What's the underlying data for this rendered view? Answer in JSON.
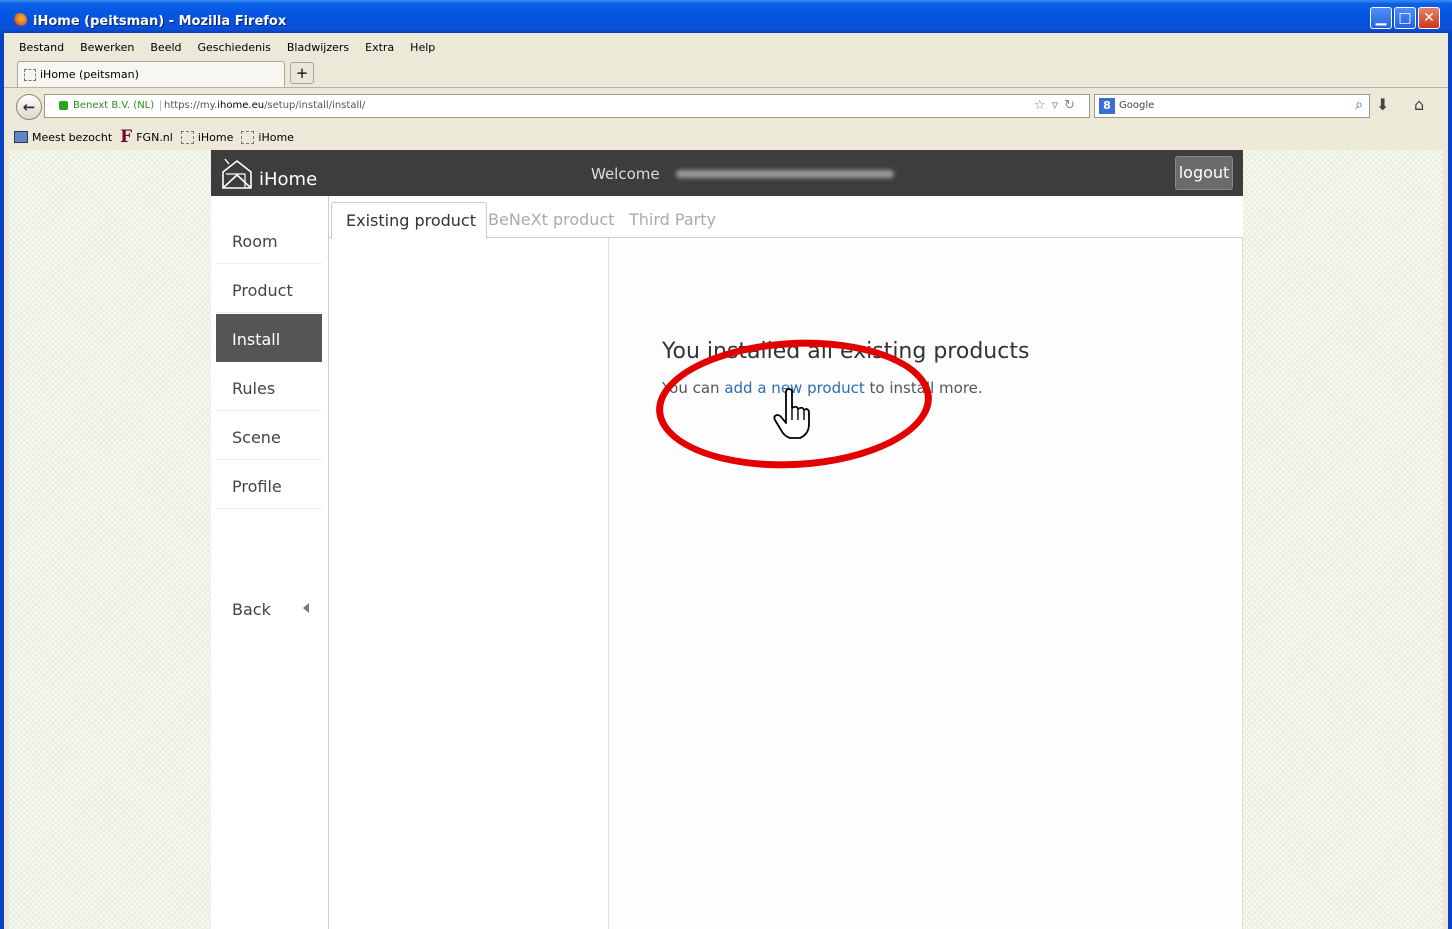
{
  "window": {
    "title": "iHome (peitsman) - Mozilla Firefox",
    "controls": [
      "minimize",
      "maximize",
      "close"
    ]
  },
  "menubar": [
    "Bestand",
    "Bewerken",
    "Beeld",
    "Geschiedenis",
    "Bladwijzers",
    "Extra",
    "Help"
  ],
  "browser": {
    "tab_title": "iHome (peitsman)",
    "new_tab_label": "+",
    "identity": "Benext B.V. (NL)",
    "url_prefix": "https://my.",
    "url_domain": "ihome.eu",
    "url_path": "/setup/install/install/",
    "search_engine": "Google",
    "bookmarks": [
      "Meest bezocht",
      "FGN.nl",
      "iHome",
      "iHome"
    ]
  },
  "app": {
    "brand": "iHome",
    "welcome": "Welcome",
    "logout": "logout",
    "sidebar": [
      {
        "label": "Room",
        "active": false
      },
      {
        "label": "Product",
        "active": false
      },
      {
        "label": "Install",
        "active": true
      },
      {
        "label": "Rules",
        "active": false
      },
      {
        "label": "Scene",
        "active": false
      },
      {
        "label": "Profile",
        "active": false
      }
    ],
    "back": "Back",
    "tabs": [
      {
        "label": "Existing product",
        "active": true
      },
      {
        "label": "BeNeXt product",
        "active": false
      },
      {
        "label": "Third Party",
        "active": false
      }
    ],
    "heading": "You installed all existing products",
    "info_before": "You can ",
    "info_link": "add a new product",
    "info_after": " to install more."
  },
  "colors": {
    "topbar": "#3d3d3d",
    "active_nav": "#555555",
    "link": "#2a6db3",
    "annotation": "#e30000"
  }
}
